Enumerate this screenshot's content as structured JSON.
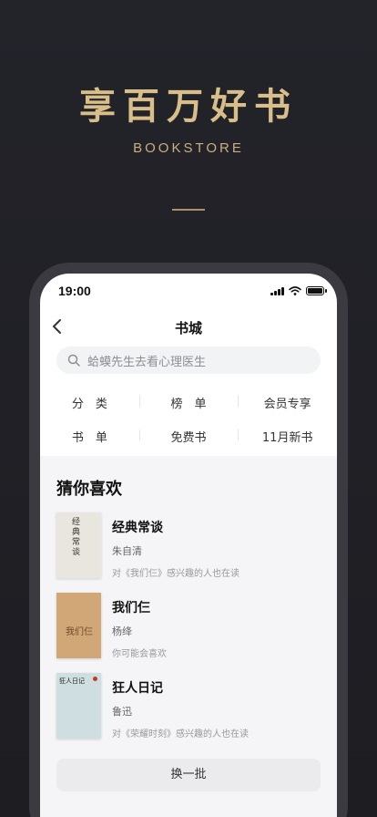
{
  "promo": {
    "title": "享百万好书",
    "subtitle": "BOOKSTORE"
  },
  "status_bar": {
    "time": "19:00"
  },
  "nav": {
    "title": "书城"
  },
  "search": {
    "placeholder": "蛤蟆先生去看心理医生"
  },
  "menu": {
    "rows": [
      [
        "分　类",
        "榜　单",
        "会员专享"
      ],
      [
        "书　单",
        "免费书",
        "11月新书"
      ]
    ]
  },
  "recommend": {
    "title": "猜你喜欢",
    "books": [
      {
        "title": "经典常谈",
        "author": "朱自清",
        "reason": "对《我们仨》感兴趣的人也在读",
        "cover_text": "经典常谈"
      },
      {
        "title": "我们仨",
        "author": "杨绛",
        "reason": "你可能会喜欢",
        "cover_text": "我们仨"
      },
      {
        "title": "狂人日记",
        "author": "鲁迅",
        "reason": "对《荣耀时刻》感兴趣的人也在读",
        "cover_text": "狂人日记"
      }
    ],
    "refresh_label": "换一批"
  },
  "colors": {
    "gold": "#d8bf8a",
    "background": "#1f1f24"
  }
}
